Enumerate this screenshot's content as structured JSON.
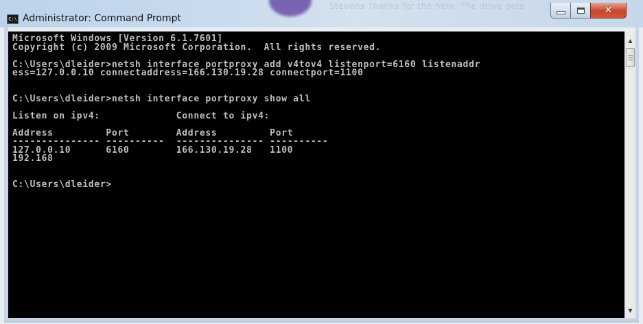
{
  "window": {
    "title": "Administrator: Command Prompt",
    "icon": "cmd-icon"
  },
  "console": {
    "lines": [
      "Microsoft Windows [Version 6.1.7601]",
      "Copyright (c) 2009 Microsoft Corporation.  All rights reserved.",
      "",
      "C:\\Users\\dleider>netsh interface portproxy add v4tov4 listenport=6160 listenaddr",
      "ess=127.0.0.10 connectaddress=166.130.19.28 connectport=1100",
      "",
      "",
      "C:\\Users\\dleider>netsh interface portproxy show all",
      "",
      "Listen on ipv4:             Connect to ipv4:",
      "",
      "Address         Port        Address         Port",
      "--------------- ----------  --------------- ----------",
      "127.0.0.10      6160        166.130.19.28   1100",
      "192.168",
      "",
      "",
      "C:\\Users\\dleider>"
    ]
  },
  "background": {
    "blurred_text": "Stevens Thanks for the help. The drive gets"
  }
}
